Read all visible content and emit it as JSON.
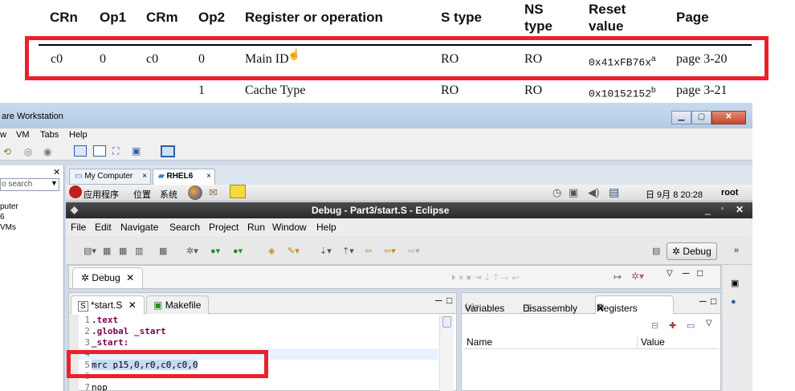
{
  "table": {
    "headers": {
      "crn": "CRn",
      "op1": "Op1",
      "crm": "CRm",
      "op2": "Op2",
      "reg": "Register or operation",
      "stype": "S type",
      "ns1": "NS",
      "ns2": "type",
      "reset1": "Reset",
      "reset2": "value",
      "page": "Page"
    },
    "rows": [
      {
        "crn": "c0",
        "op1": "0",
        "crm": "c0",
        "op2": "0",
        "reg": "Main ID",
        "stype": "RO",
        "ns": "RO",
        "reset": "0x41xFB76x",
        "reset_note": "a",
        "page": "page 3-20"
      },
      {
        "crn": "",
        "op1": "",
        "crm": "",
        "op2": "1",
        "reg": "Cache Type",
        "stype": "RO",
        "ns": "RO",
        "reset": "0x10152152",
        "reset_note": "b",
        "page": "page 3-21"
      }
    ],
    "highlight_color": "#e8212c"
  },
  "vmware": {
    "title": "are Workstation",
    "menu": {
      "view": "w",
      "vm": "VM",
      "tabs": "Tabs",
      "help": "Help"
    },
    "library": {
      "search_placeholder": "o search",
      "items": [
        "puter",
        "6",
        "VMs"
      ]
    },
    "tabs": [
      {
        "label": "My Computer",
        "close": "×"
      },
      {
        "label": "RHEL6",
        "close": "×"
      }
    ]
  },
  "gnome_panel": {
    "apps": "应用程序",
    "places": "位置",
    "system": "系统",
    "datetime": "日 9月  8 20:28",
    "user": "root"
  },
  "eclipse": {
    "title": "Debug - Part3/start.S - Eclipse",
    "menu": [
      "File",
      "Edit",
      "Navigate",
      "Search",
      "Project",
      "Run",
      "Window",
      "Help"
    ],
    "perspective": "Debug",
    "debug_tab": "Debug",
    "editor_tabs": [
      "*start.S",
      "Makefile"
    ],
    "code_lines": [
      {
        "n": "1",
        "text": ".text"
      },
      {
        "n": "2",
        "text": ".global _start"
      },
      {
        "n": "3",
        "text": "_start:"
      },
      {
        "n": "4",
        "text": ""
      },
      {
        "n": "5",
        "text": "mrc p15,0,r0,c0,c0,0"
      },
      {
        "n": "6",
        "text": ""
      },
      {
        "n": "7",
        "text": "nop"
      }
    ],
    "right_tabs": [
      "Variables",
      "Disassembly",
      "Registers"
    ],
    "columns": {
      "name": "Name",
      "value": "Value"
    }
  }
}
